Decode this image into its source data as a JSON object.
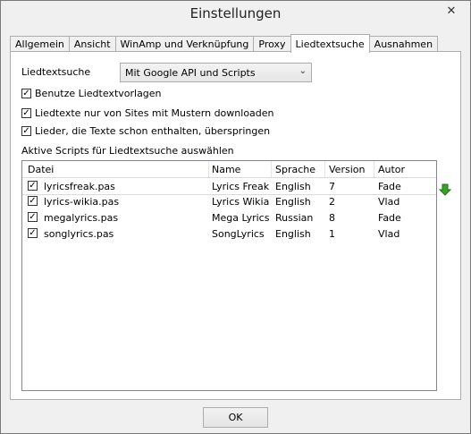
{
  "window": {
    "title": "Einstellungen",
    "close_glyph": "✕"
  },
  "tabs": [
    {
      "label": "Allgemein"
    },
    {
      "label": "Ansicht"
    },
    {
      "label": "WinAmp und Verknüpfung"
    },
    {
      "label": "Proxy"
    },
    {
      "label": "Liedtextsuche",
      "active": true
    },
    {
      "label": "Ausnahmen"
    }
  ],
  "form": {
    "search_label": "Liedtextsuche",
    "search_value": "Mit Google API und Scripts",
    "options": [
      {
        "label": "Benutze Liedtextvorlagen",
        "checked": true
      },
      {
        "label": "Liedtexte nur von Sites mit Mustern downloaden",
        "checked": true
      },
      {
        "label": "Lieder, die Texte schon enthalten, überspringen",
        "checked": true
      }
    ],
    "scripts_label": "Aktive Scripts für Liedtextsuche auswählen"
  },
  "scripts": {
    "columns": [
      "Datei",
      "Name",
      "Sprache",
      "Version",
      "Autor"
    ],
    "rows": [
      {
        "file": "lyricsfreak.pas",
        "name": "Lyrics Freak",
        "lang": "English",
        "version": "7",
        "author": "Fade",
        "checked": true
      },
      {
        "file": "lyrics-wikia.pas",
        "name": "Lyrics Wikia",
        "lang": "English",
        "version": "2",
        "author": "Vlad",
        "checked": true
      },
      {
        "file": "megalyrics.pas",
        "name": "Mega Lyrics",
        "lang": "Russian",
        "version": "8",
        "author": "Fade",
        "checked": true
      },
      {
        "file": "songlyrics.pas",
        "name": "SongLyrics",
        "lang": "English",
        "version": "1",
        "author": "Vlad",
        "checked": true
      }
    ]
  },
  "icons": {
    "move_down": "green-down-arrow-icon",
    "accent": "#3aa02a"
  },
  "buttons": {
    "ok": "OK"
  }
}
